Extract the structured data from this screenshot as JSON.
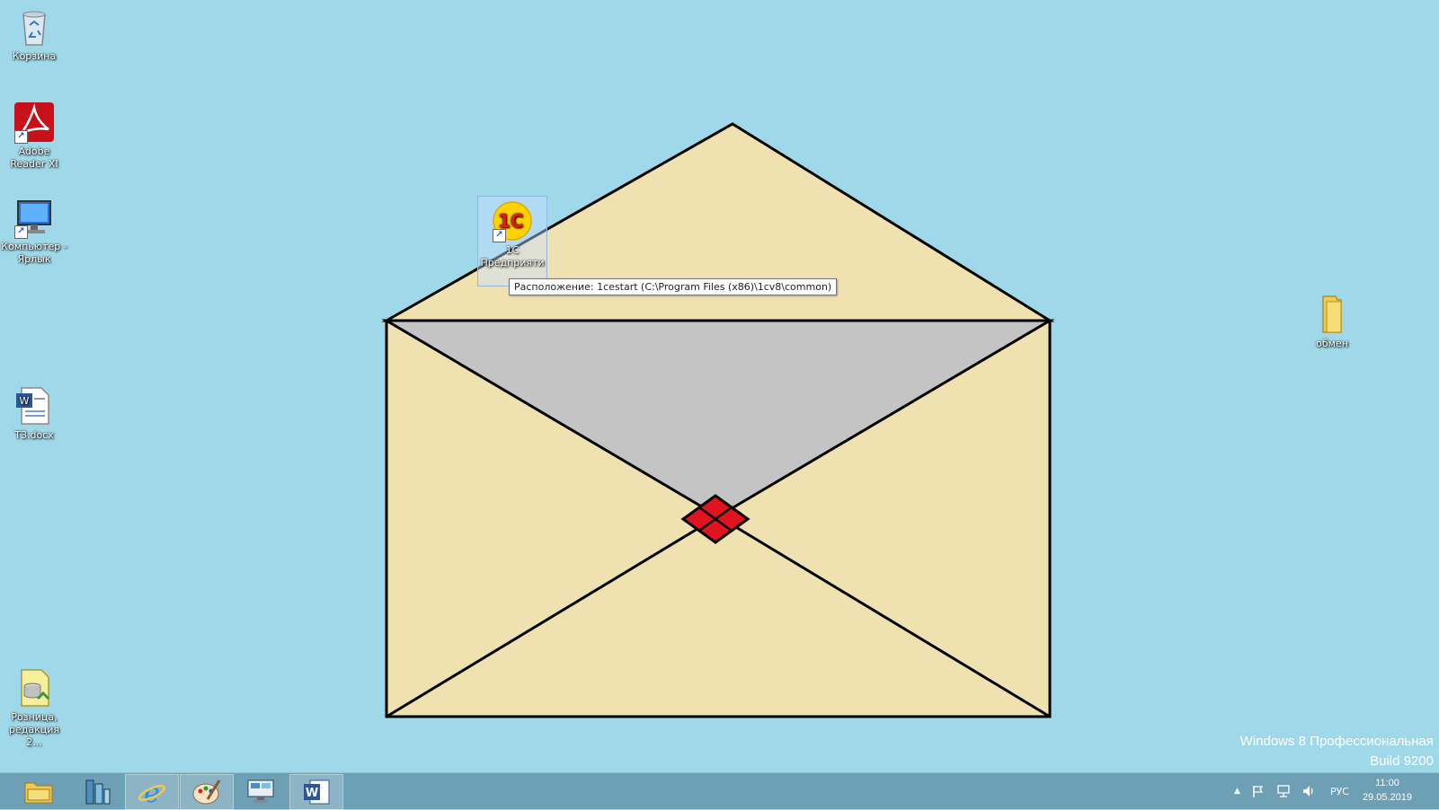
{
  "desktop": {
    "icons": {
      "recycle": "Корзина",
      "adobe": "Adobe Reader XI",
      "computer": "Компьютер - Ярлык",
      "tz": "ТЗ.docx",
      "roznica": "Розница, редакция 2...",
      "onec": "1С Предприяти",
      "obmen": "обмен"
    },
    "tooltip": "Расположение: 1cestart (C:\\Program Files (x86)\\1cv8\\common)",
    "watermark": {
      "line1": "Windows 8 Профессиональная",
      "line2": "Build 9200"
    }
  },
  "taskbar": {
    "lang": "РУС",
    "time": "11:00",
    "date": "29.05.2019"
  },
  "colors": {
    "background": "#9fd8e8",
    "envelope": "#f0e2b0",
    "envelope_inside": "#c4c4c4",
    "seal": "#e0141e",
    "taskbar": "#6d9fb5"
  }
}
